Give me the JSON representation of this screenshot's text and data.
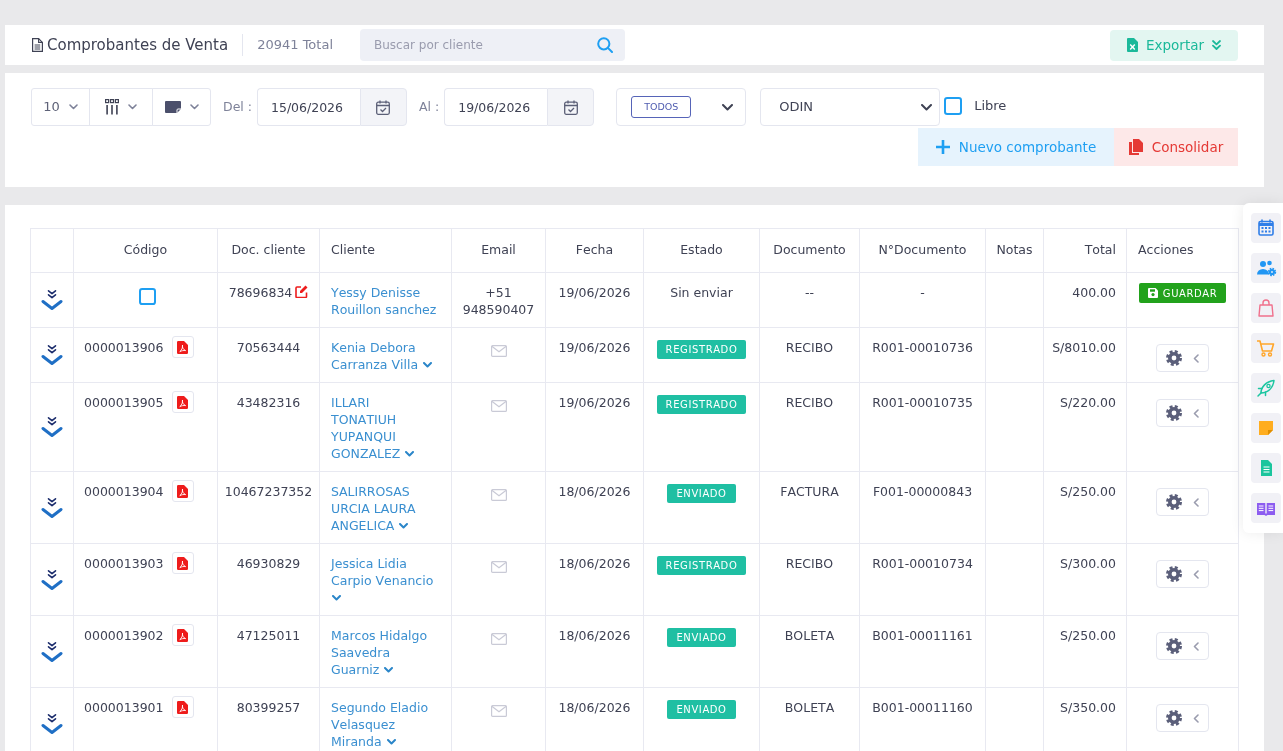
{
  "header": {
    "title": "Comprobantes de Venta",
    "total": "20941 Total",
    "search": {
      "placeholder": "Buscar por cliente"
    },
    "export_button": "Exportar"
  },
  "filters": {
    "page_size": "10",
    "date_from": {
      "label": "Del :",
      "value": "15/06/2026"
    },
    "date_to": {
      "label": "Al :",
      "value": "19/06/2026"
    },
    "status": "TODOS",
    "series": "ODIN",
    "libre": {
      "label": "Libre",
      "checked": false
    },
    "buttons": [
      {
        "kind": "new",
        "label": "Nuevo comprobante"
      },
      {
        "kind": "consolidate",
        "label": "Consolidar"
      }
    ]
  },
  "table": {
    "columns": [
      "Código",
      "Doc. cliente",
      "Cliente",
      "Email",
      "Fecha",
      "Estado",
      "Documento",
      "N°Documento",
      "Notas",
      "Total",
      "Acciones"
    ],
    "rows": [
      {
        "kind": "draft",
        "checked": false,
        "doc_cliente": "78696834",
        "cliente": "Yessy Denisse Rouillon sanchez",
        "email": "+51 948590407",
        "fecha": "19/06/2026",
        "estado": "Sin enviar",
        "documento": "--",
        "numero": "-",
        "total": "400.00",
        "action": "GUARDAR"
      },
      {
        "kind": "issued",
        "codigo": "0000013906",
        "doc_cliente": "70563444",
        "cliente": "Kenia Debora Carranza Villa",
        "fecha": "19/06/2026",
        "estado": "REGISTRADO",
        "documento": "RECIBO",
        "numero": "R001-00010736",
        "total": "S/8010.00"
      },
      {
        "kind": "issued",
        "codigo": "0000013905",
        "doc_cliente": "43482316",
        "cliente": "ILLARI TONATIUH YUPANQUI GONZALEZ",
        "fecha": "19/06/2026",
        "estado": "REGISTRADO",
        "documento": "RECIBO",
        "numero": "R001-00010735",
        "total": "S/220.00"
      },
      {
        "kind": "issued",
        "codigo": "0000013904",
        "doc_cliente": "10467237352",
        "cliente": "SALIRROSAS URCIA LAURA ANGELICA",
        "fecha": "18/06/2026",
        "estado": "ENVIADO",
        "documento": "FACTURA",
        "numero": "F001-00000843",
        "total": "S/250.00"
      },
      {
        "kind": "issued",
        "codigo": "0000013903",
        "doc_cliente": "46930829",
        "cliente": "Jessica Lidia Carpio Venancio",
        "fecha": "18/06/2026",
        "estado": "REGISTRADO",
        "documento": "RECIBO",
        "numero": "R001-00010734",
        "total": "S/300.00"
      },
      {
        "kind": "issued",
        "codigo": "0000013902",
        "doc_cliente": "47125011",
        "cliente": "Marcos Hidalgo Saavedra Guarniz",
        "fecha": "18/06/2026",
        "estado": "ENVIADO",
        "documento": "BOLETA",
        "numero": "B001-00011161",
        "total": "S/250.00"
      },
      {
        "kind": "issued",
        "codigo": "0000013901",
        "doc_cliente": "80399257",
        "cliente": "Segundo Eladio Velasquez Miranda",
        "fecha": "18/06/2026",
        "estado": "ENVIADO",
        "documento": "BOLETA",
        "numero": "B001-00011160",
        "total": "S/350.00"
      }
    ]
  }
}
